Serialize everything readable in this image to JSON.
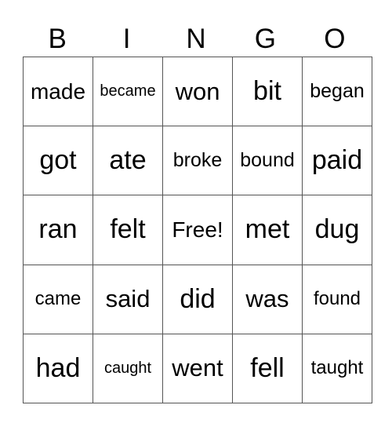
{
  "header": [
    "B",
    "I",
    "N",
    "G",
    "O"
  ],
  "rows": [
    [
      "made",
      "became",
      "won",
      "bit",
      "began"
    ],
    [
      "got",
      "ate",
      "broke",
      "bound",
      "paid"
    ],
    [
      "ran",
      "felt",
      "Free!",
      "met",
      "dug"
    ],
    [
      "came",
      "said",
      "did",
      "was",
      "found"
    ],
    [
      "had",
      "caught",
      "went",
      "fell",
      "taught"
    ]
  ]
}
